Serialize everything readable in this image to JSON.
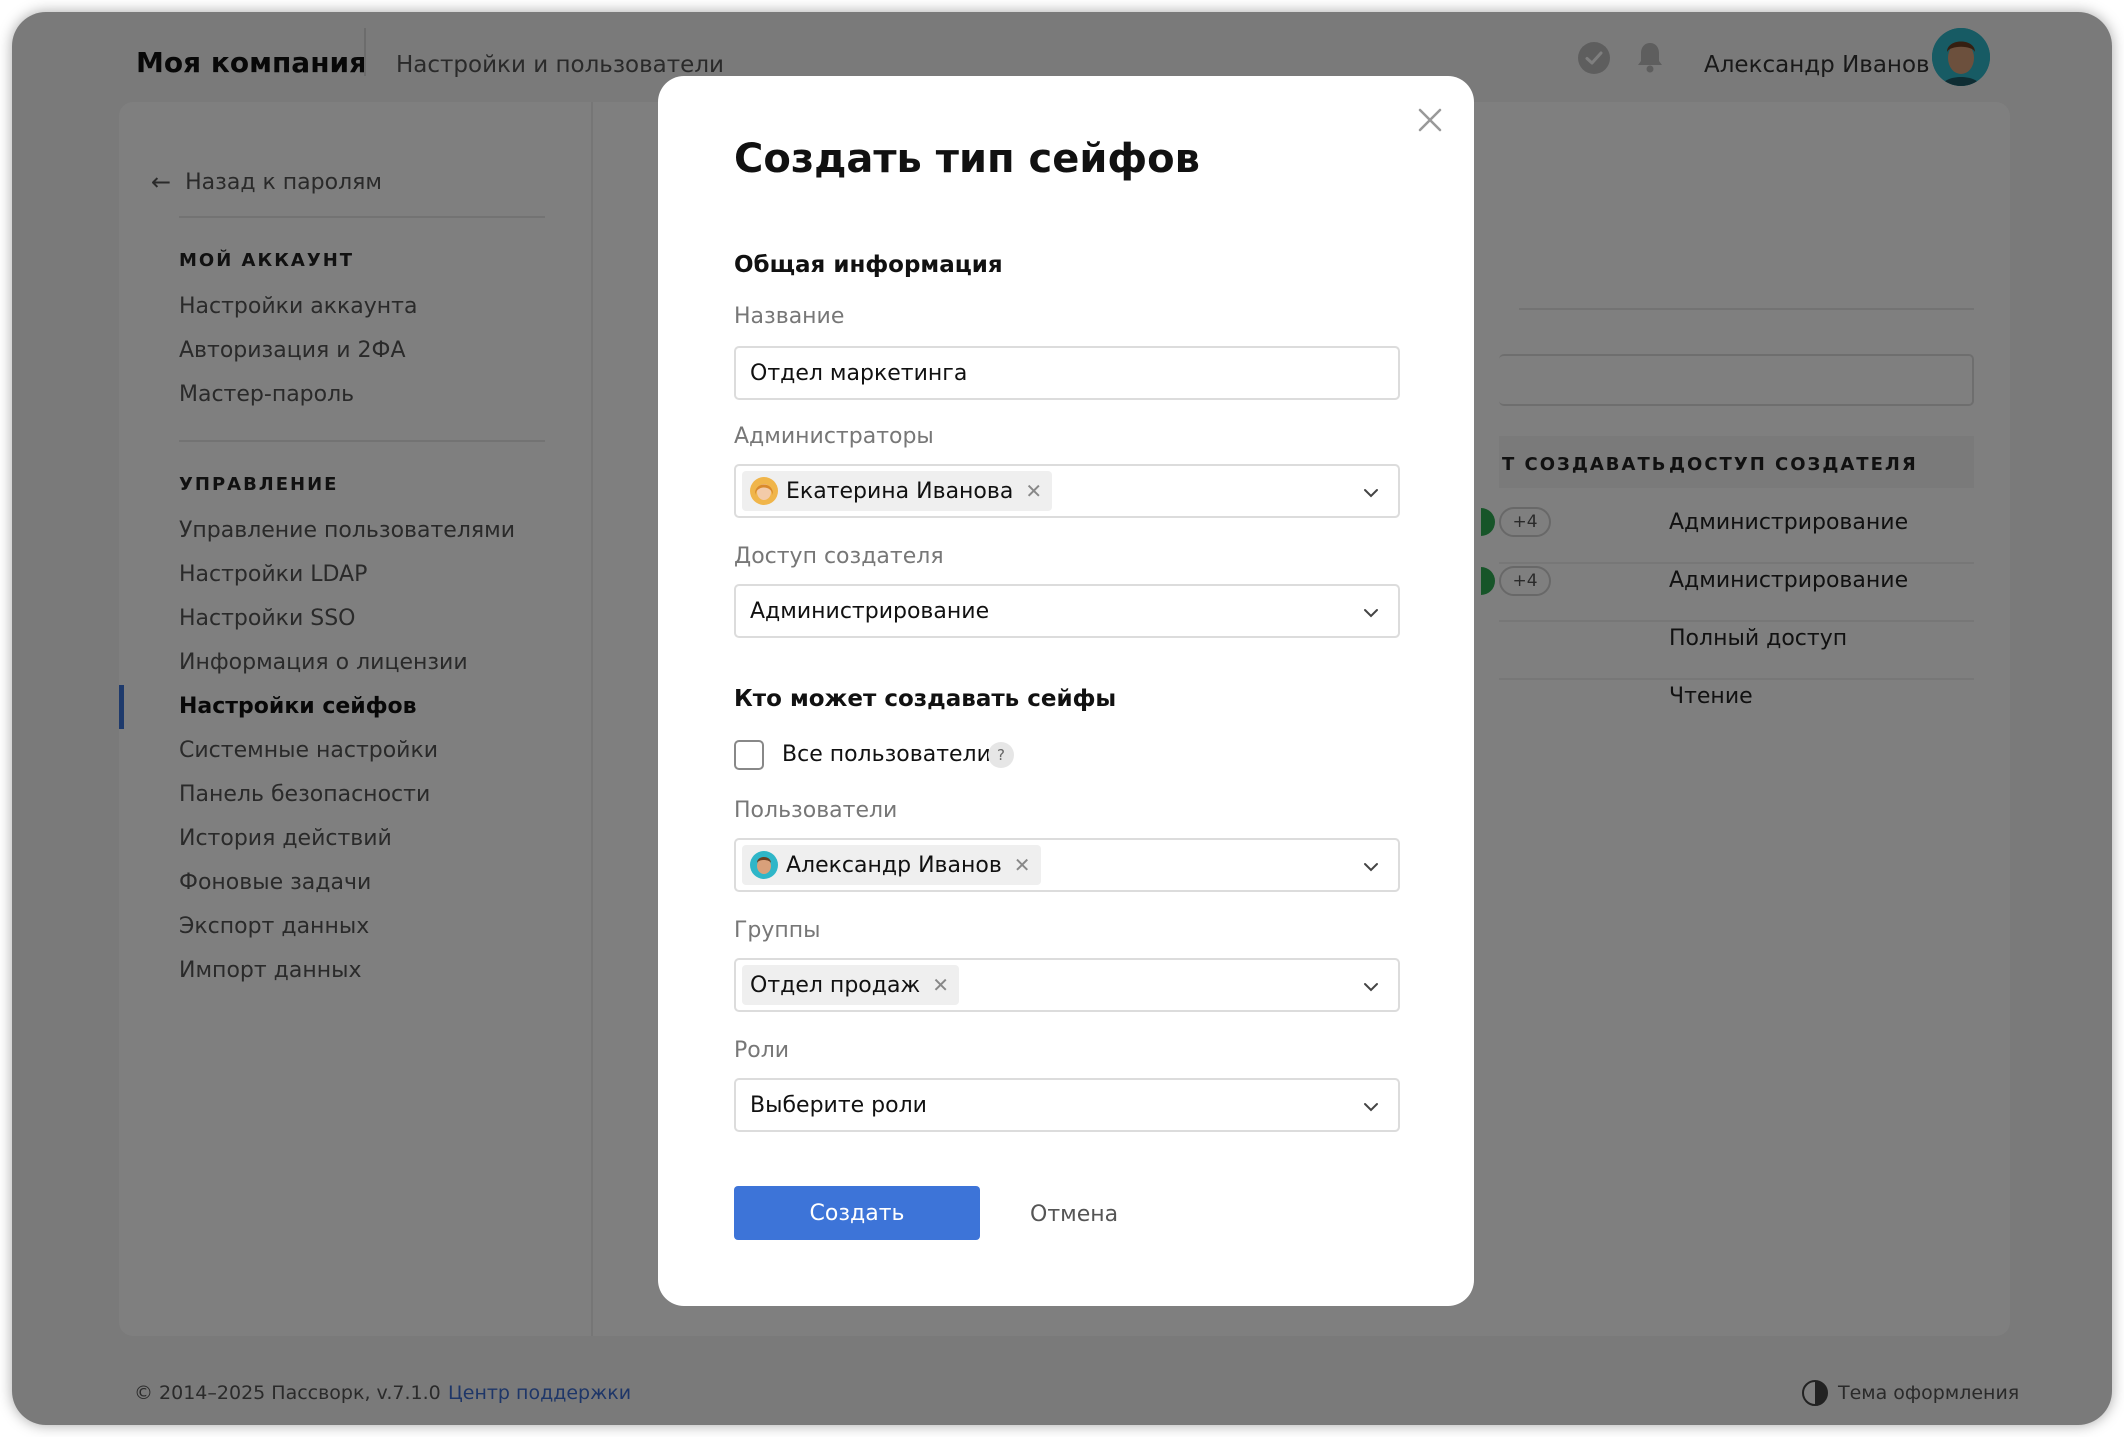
{
  "header": {
    "company": "Моя компания",
    "section": "Настройки и пользователи",
    "user_name": "Александр Иванов"
  },
  "sidebar": {
    "back_label": "Назад к паролям",
    "account_heading": "МОЙ АККАУНТ",
    "account_items": [
      "Настройки аккаунта",
      "Авторизация и 2ФА",
      "Мастер-пароль"
    ],
    "manage_heading": "УПРАВЛЕНИЕ",
    "manage_items": [
      "Управление пользователями",
      "Настройки LDAP",
      "Настройки SSO",
      "Информация о лицензии",
      "Настройки сейфов",
      "Системные настройки",
      "Панель безопасности",
      "История действий",
      "Фоновые задачи",
      "Экспорт данных",
      "Импорт данных"
    ],
    "active_item": "Настройки сейфов"
  },
  "table": {
    "col_can_create": "Т СОЗДАВАТЬ",
    "col_creator_access": "ДОСТУП СОЗДАТЕЛЯ",
    "rows": [
      {
        "extra": "+4",
        "access": "Администрирование"
      },
      {
        "extra": "+4",
        "access": "Администрирование"
      },
      {
        "extra": "",
        "access": "Полный доступ"
      },
      {
        "extra": "",
        "access": "Чтение"
      }
    ]
  },
  "footer": {
    "copyright": "© 2014–2025 Пассворк, v.7.1.0",
    "support_link": "Центр поддержки",
    "theme_label": "Тема оформления"
  },
  "modal": {
    "title": "Создать тип сейфов",
    "general_section": "Общая информация",
    "name_label": "Название",
    "name_value": "Отдел маркетинга",
    "admins_label": "Администраторы",
    "admins_chip": "Екатерина Иванова",
    "creator_access_label": "Доступ создателя",
    "creator_access_value": "Администрирование",
    "who_section": "Кто может создавать сейфы",
    "all_users_label": "Все пользователи",
    "all_users_checked": false,
    "help_glyph": "?",
    "users_label": "Пользователи",
    "users_chip": "Александр Иванов",
    "groups_label": "Группы",
    "groups_chip": "Отдел продаж",
    "roles_label": "Роли",
    "roles_placeholder": "Выберите роли",
    "create_button": "Создать",
    "cancel_button": "Отмена"
  },
  "colors": {
    "accent": "#3d74d8",
    "link": "#3d6dd0",
    "overlay": "rgba(0,0,0,0.5)"
  }
}
